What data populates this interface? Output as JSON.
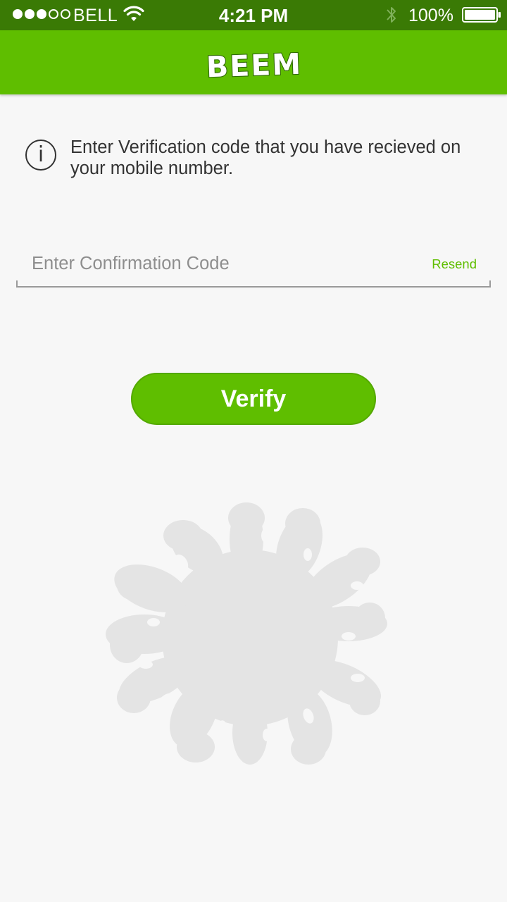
{
  "status_bar": {
    "signal_dots_filled": 3,
    "signal_dots_total": 5,
    "carrier": "BELL",
    "time": "4:21 PM",
    "battery_percent": "100%",
    "icons": [
      "wifi-icon",
      "bluetooth-icon",
      "battery-icon"
    ]
  },
  "nav_bar": {
    "logo_text": "BEEM",
    "background_color": "#5fbe00"
  },
  "info": {
    "icon": "info-icon",
    "icon_glyph": "i",
    "message": "Enter Verification code that you have recieved on your mobile number."
  },
  "code_field": {
    "value": "",
    "placeholder": "Enter Confirmation Code",
    "resend_label": "Resend"
  },
  "verify_button": {
    "label": "Verify"
  },
  "colors": {
    "accent": "#5fbe00",
    "status_bar": "#3a7a05",
    "background": "#f7f7f7",
    "splash": "#e4e4e4"
  }
}
